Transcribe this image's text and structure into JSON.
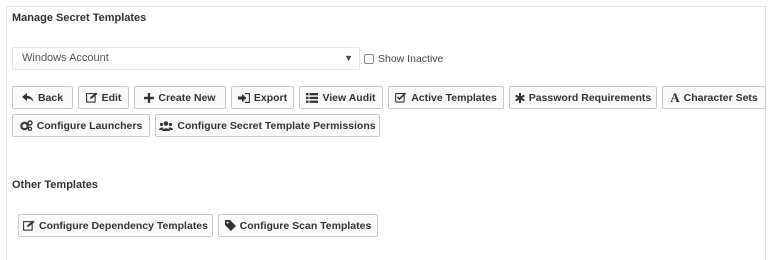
{
  "header": {
    "title": "Manage Secret Templates"
  },
  "template_select": {
    "value": "Windows Account"
  },
  "show_inactive": {
    "label": "Show Inactive",
    "checked": false
  },
  "toolbar": {
    "back": "Back",
    "edit": "Edit",
    "create_new": "Create New",
    "export": "Export",
    "view_audit": "View Audit",
    "active_templates": "Active Templates",
    "password_requirements": "Password Requirements",
    "character_sets": "Character Sets",
    "configure_launchers": "Configure Launchers",
    "configure_permissions": "Configure Secret Template Permissions"
  },
  "other_templates": {
    "title": "Other Templates",
    "configure_dependency": "Configure Dependency Templates",
    "configure_scan": "Configure Scan Templates"
  },
  "icons": {
    "back": "back-arrow-icon",
    "edit": "edit-icon",
    "create_new": "plus-icon",
    "export": "export-icon",
    "view_audit": "list-icon",
    "active_templates": "check-square-icon",
    "password_requirements": "asterisk-icon",
    "character_sets": "font-icon",
    "configure_launchers": "gears-icon",
    "configure_permissions": "users-icon",
    "configure_dependency": "edit-icon",
    "configure_scan": "tag-icon"
  }
}
